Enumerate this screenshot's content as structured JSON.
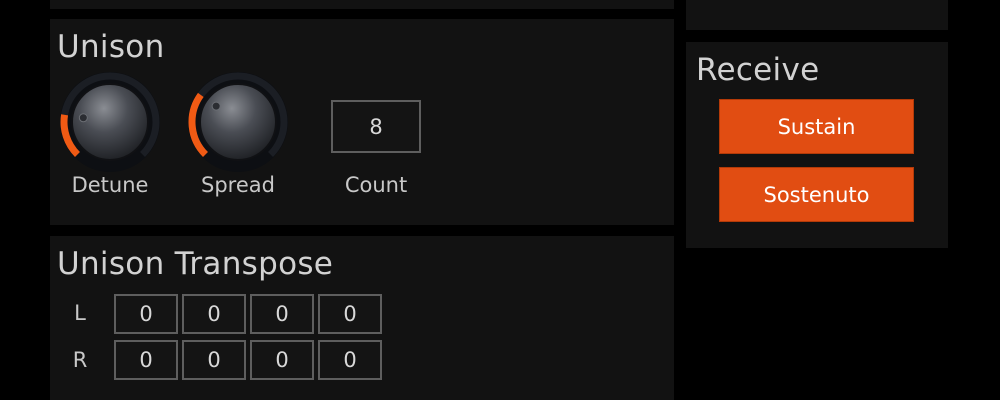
{
  "unison": {
    "title": "Unison",
    "detune": {
      "label": "Detune",
      "value": 0.2
    },
    "spread": {
      "label": "Spread",
      "value": 0.3
    },
    "count": {
      "label": "Count",
      "value": "8"
    }
  },
  "transpose": {
    "title": "Unison Transpose",
    "rows": [
      {
        "label": "L",
        "values": [
          "0",
          "0",
          "0",
          "0"
        ]
      },
      {
        "label": "R",
        "values": [
          "0",
          "0",
          "0",
          "0"
        ]
      }
    ]
  },
  "receive": {
    "title": "Receive",
    "buttons": [
      "Sustain",
      "Sostenuto"
    ]
  },
  "colors": {
    "accent": "#e14d12",
    "arc": "#f05a14",
    "track": "#1b1e24"
  },
  "icons": {
    "knob": "rotary-knob-icon"
  }
}
